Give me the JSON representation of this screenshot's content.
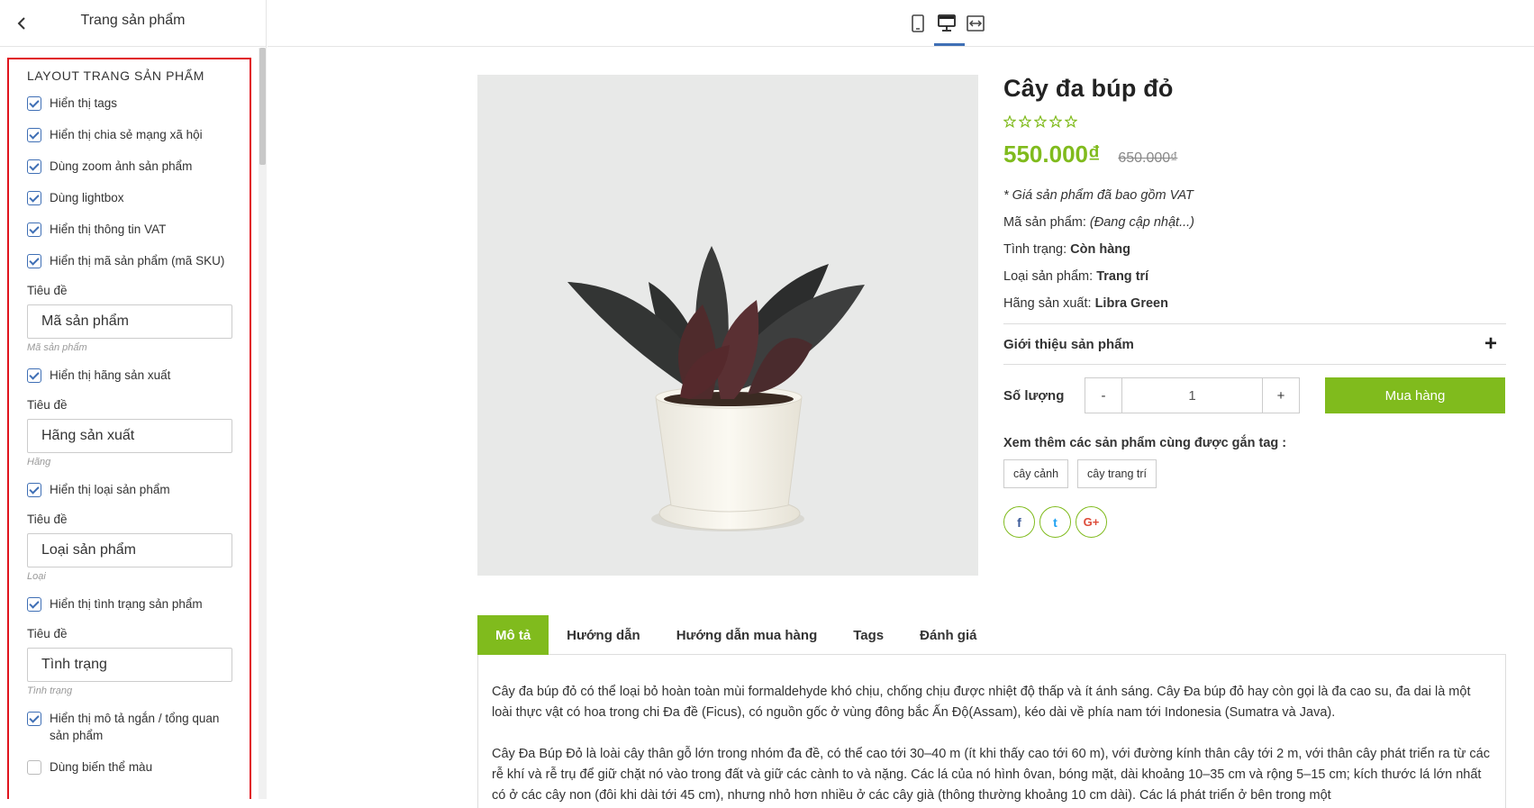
{
  "sidebar": {
    "title": "Trang sản phẩm",
    "section_title": "LAYOUT TRANG SẢN PHẨM",
    "opt_tags": "Hiển thị tags",
    "opt_share": "Hiển thị chia sẻ mạng xã hội",
    "opt_zoom": "Dùng zoom ảnh sản phẩm",
    "opt_lightbox": "Dùng lightbox",
    "opt_vat": "Hiển thị thông tin VAT",
    "opt_sku": "Hiển thị mã sản phẩm (mã SKU)",
    "field_label": "Tiêu đề",
    "sku_title_value": "Mã sản phẩm",
    "sku_hint": "Mã sản phẩm",
    "opt_vendor": "Hiển thị hãng sản xuất",
    "vendor_title_value": "Hãng sản xuất",
    "vendor_hint": "Hãng",
    "opt_type": "Hiển thị loại sản phẩm",
    "type_title_value": "Loại sản phẩm",
    "type_hint": "Loại",
    "opt_status": "Hiển thị tình trạng sản phẩm",
    "status_title_value": "Tình trạng",
    "status_hint": "Tình trạng",
    "opt_summary": "Hiển thị mô tả ngắn / tổng quan sản phẩm",
    "opt_color_variant": "Dùng biến thể màu"
  },
  "product": {
    "name": "Cây đa búp đỏ",
    "rating": 0,
    "price": "550.000₫",
    "old_price": "650.000₫",
    "vat_note": "* Giá sản phẩm đã bao gồm VAT",
    "sku_label": "Mã sản phẩm:",
    "sku_value": "(Đang cập nhật...)",
    "status_label": "Tình trạng:",
    "status_value": "Còn hàng",
    "type_label": "Loại sản phẩm:",
    "type_value": "Trang trí",
    "vendor_label": "Hãng sản xuất:",
    "vendor_value": "Libra Green",
    "intro_label": "Giới thiệu sản phẩm",
    "qty_label": "Số lượng",
    "qty_minus": "-",
    "qty_value": "1",
    "qty_plus": "+",
    "buy_label": "Mua hàng",
    "tags_title": "Xem thêm các sản phẩm cùng được gắn tag :",
    "tags": [
      "cây cảnh",
      "cây trang trí"
    ],
    "social": {
      "facebook": "f",
      "twitter": "t",
      "google": "G+"
    }
  },
  "tabs": [
    "Mô tả",
    "Hướng dẫn",
    "Hướng dẫn mua hàng",
    "Tags",
    "Đánh giá"
  ],
  "description": [
    "Cây đa búp đỏ có thể loại bỏ hoàn toàn mùi formaldehyde khó chịu, chống chịu được nhiệt độ thấp và ít ánh sáng. Cây Đa búp đỏ hay còn gọi là đa cao su, đa dai là một loài thực vật có hoa trong chi Đa đề (Ficus), có nguồn gốc ở vùng đông bắc Ấn Độ(Assam), kéo dài về phía nam tới Indonesia (Sumatra và Java).",
    "Cây Đa Búp Đỏ là loài cây thân gỗ lớn trong nhóm đa đề, có thể cao tới 30–40 m (ít khi thấy cao tới 60 m), với đường kính thân cây tới 2 m, với thân cây phát triển ra  từ các rễ khí và rễ trụ để giữ chặt nó vào trong đất và giữ các cành to và nặng. Các lá của nó hình ôvan, bóng mặt, dài khoảng 10–35 cm và rộng 5–15 cm;  kích thước lá lớn nhất có ở các cây non (đôi khi dài tới 45 cm), nhưng nhỏ hơn nhiều ở các cây già (thông thường khoảng 10 cm dài). Các lá phát triển ở bên trong một"
  ],
  "colors": {
    "accent": "#80bb1d",
    "highlight_border": "#e0141e",
    "checkbox": "#3f6fb5"
  }
}
